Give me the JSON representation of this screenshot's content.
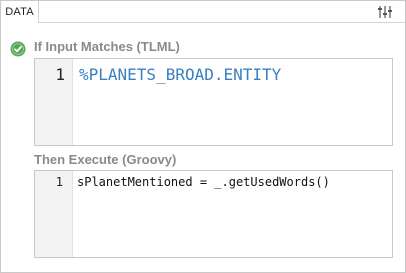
{
  "tab": {
    "label": "DATA"
  },
  "icons": {
    "settings": "sliders-settings-icon",
    "status": "check-circle-icon"
  },
  "colors": {
    "status_green": "#5aa55a",
    "code_blue": "#3a7fc2",
    "title_gray": "#8a8a8a"
  },
  "match_section": {
    "title": "If Input Matches (TLML)",
    "line_number": "1",
    "code": "%PLANETS_BROAD.ENTITY"
  },
  "execute_section": {
    "title": "Then Execute (Groovy)",
    "line_number": "1",
    "code": "sPlanetMentioned = _.getUsedWords()"
  }
}
